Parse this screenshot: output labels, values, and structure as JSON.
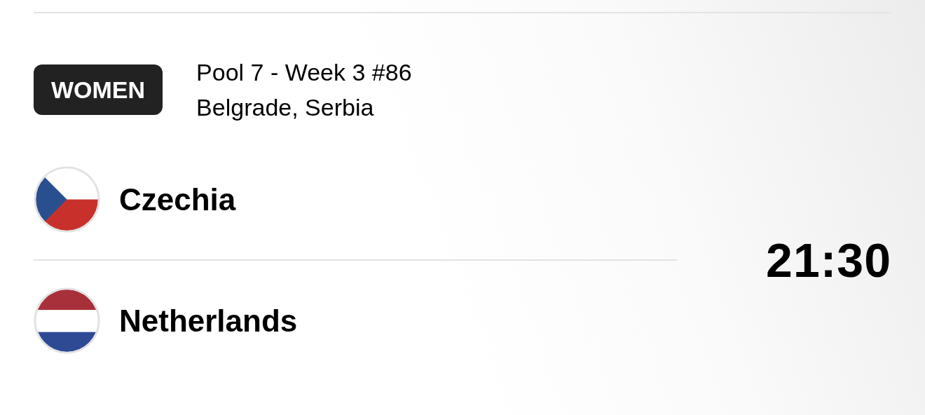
{
  "match": {
    "category": "WOMEN",
    "pool": "Pool 7 - Week 3 #86",
    "venue": "Belgrade, Serbia",
    "time": "21:30"
  },
  "teams": [
    {
      "name": "Czechia",
      "kind": "triangle"
    },
    {
      "name": "Netherlands",
      "kind": "stripes"
    }
  ]
}
